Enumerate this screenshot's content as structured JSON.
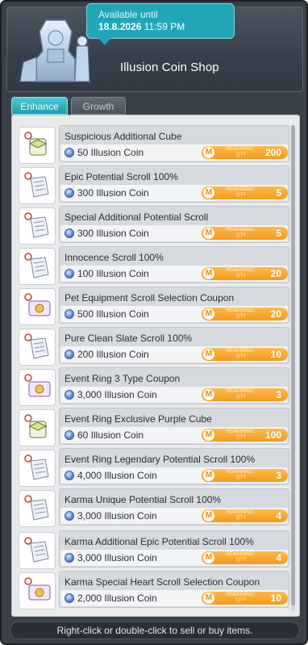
{
  "shop": {
    "title": "Illusion Coin Shop",
    "availability_label": "Available until",
    "availability_date": "18.8.2026",
    "availability_time": "11:59 PM"
  },
  "tabs": [
    {
      "label": "Enhance",
      "active": true
    },
    {
      "label": "Growth",
      "active": false
    }
  ],
  "remaining_label": "REMAINING : QTY",
  "currency_icon": "illusion-coin-icon",
  "items": [
    {
      "name": "Suspicious Additional Cube",
      "price": "50 Illusion Coin",
      "remaining": "200",
      "icon": "cube-icon"
    },
    {
      "name": "Epic Potential Scroll 100%",
      "price": "300 Illusion Coin",
      "remaining": "5",
      "icon": "scroll-icon"
    },
    {
      "name": "Special Additional Potential Scroll",
      "price": "300 Illusion Coin",
      "remaining": "5",
      "icon": "scroll-icon"
    },
    {
      "name": "Innocence Scroll 100%",
      "price": "100 Illusion Coin",
      "remaining": "20",
      "icon": "scroll-icon"
    },
    {
      "name": "Pet Equipment Scroll Selection Coupon",
      "price": "500 Illusion Coin",
      "remaining": "20",
      "icon": "coupon-icon"
    },
    {
      "name": "Pure Clean Slate Scroll 100%",
      "price": "200 Illusion Coin",
      "remaining": "10",
      "icon": "scroll-icon"
    },
    {
      "name": "Event Ring 3 Type Coupon",
      "price": "3,000 Illusion Coin",
      "remaining": "3",
      "icon": "coupon-icon"
    },
    {
      "name": "Event Ring Exclusive Purple Cube",
      "price": "60 Illusion Coin",
      "remaining": "100",
      "icon": "cube-icon"
    },
    {
      "name": "Event Ring Legendary Potential Scroll 100%",
      "price": "4,000 Illusion Coin",
      "remaining": "3",
      "icon": "scroll-icon"
    },
    {
      "name": "Karma Unique Potential Scroll 100%",
      "price": "3,000 Illusion Coin",
      "remaining": "4",
      "icon": "scroll-icon"
    },
    {
      "name": "Karma Additional Epic Potential Scroll 100%",
      "price": "3,000 Illusion Coin",
      "remaining": "4",
      "icon": "scroll-icon"
    },
    {
      "name": "Karma Special Heart Scroll Selection Coupon",
      "price": "2,000 Illusion Coin",
      "remaining": "10",
      "icon": "coupon-icon"
    }
  ],
  "footer": {
    "hint": "Right-click or double-click to sell or buy items."
  },
  "colors": {
    "accent": "#21a6b8",
    "remaining_pill": "#f59a1a",
    "window_bg": "#3a4048"
  }
}
